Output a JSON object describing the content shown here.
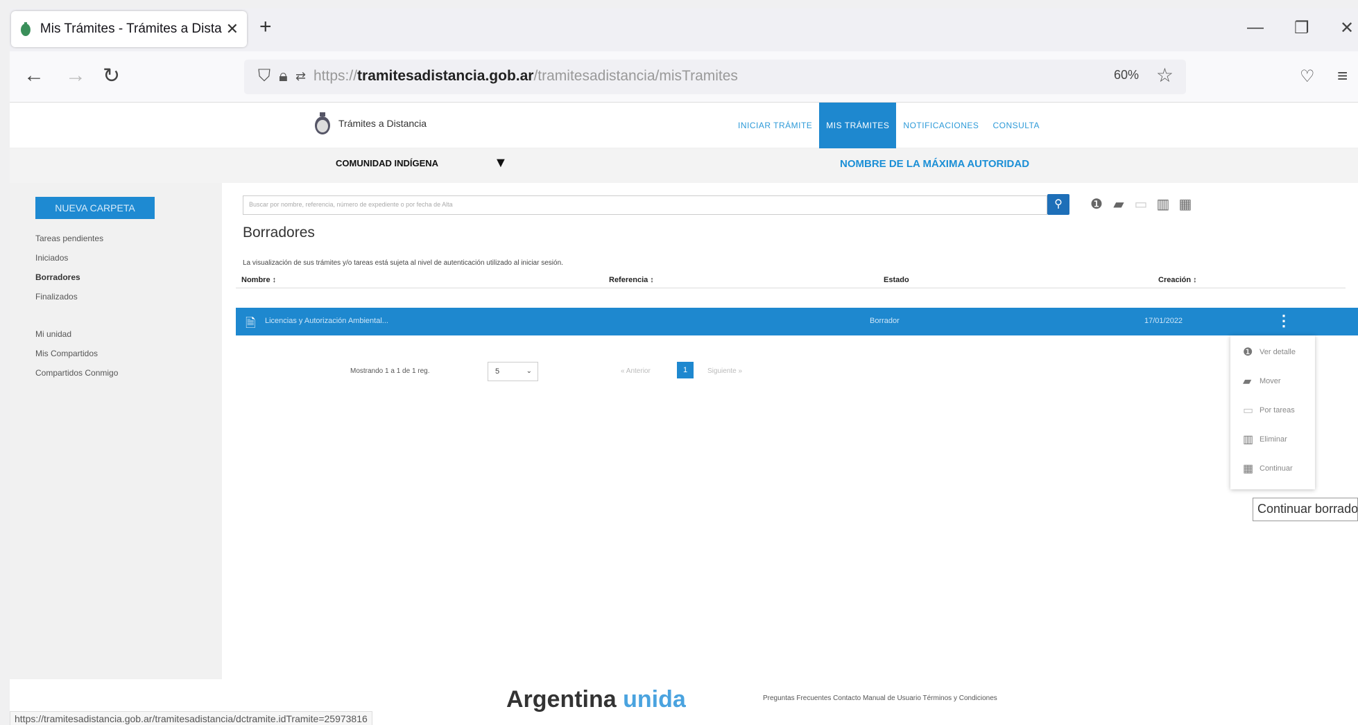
{
  "browser": {
    "tab_title": "Mis Trámites - Trámites a Dista",
    "tab_close": "✕",
    "new_tab": "+",
    "url_scheme": "https://",
    "url_host": "tramitesadistancia.gob.ar",
    "url_path": "/tramitesadistancia/misTramites",
    "zoom": "60%",
    "status_url": "https://tramitesadistancia.gob.ar/tramitesadistancia/dctramite.idTramite=25973816"
  },
  "site": {
    "logo_title": "Trámites a Distancia",
    "nav": [
      "INICIAR TRÁMITE",
      "MIS TRÁMITES",
      "NOTIFICACIONES",
      "CONSULTA"
    ]
  },
  "overlay": {
    "left_label": "COMUNIDAD INDÍGENA",
    "right_label": "NOMBRE DE LA MÁXIMA AUTORIDAD"
  },
  "sidebar": {
    "new_folder": "NUEVA CARPETA",
    "group1": [
      "Tareas pendientes",
      "Iniciados",
      "Borradores",
      "Finalizados"
    ],
    "group2": [
      "Mi unidad",
      "Mis Compartidos",
      "Compartidos Conmigo"
    ]
  },
  "main": {
    "search_placeholder": "Buscar por nombre, referencia, número de expediente o por fecha de Alta",
    "title": "Borradores",
    "notice": "La visualización de sus trámites y/o tareas está sujeta al nivel de autenticación utilizado al iniciar sesión.",
    "columns": [
      "Nombre ↕",
      "Referencia ↕",
      "Estado",
      "Creación ↕"
    ],
    "row": {
      "name": "Licencias y Autorización Ambiental...",
      "status": "Borrador",
      "created": "17/01/2022"
    },
    "pager_info": "Mostrando 1 a 1 de 1 reg.",
    "per_page": "5",
    "prev": "« Anterior",
    "page": "1",
    "next": "Siguiente »"
  },
  "menu": {
    "items": [
      "Ver detalle",
      "Mover",
      "Por tareas",
      "Eliminar",
      "Continuar"
    ]
  },
  "tooltip": "Continuar borrado",
  "footer": {
    "brand_1": "Argentina",
    "brand_2": "unida",
    "links": "Preguntas Frecuentes  Contacto  Manual de Usuario  Términos y Condiciones"
  },
  "colors": {
    "accent": "#1e88cf",
    "highlight": "#1b8fd6"
  }
}
